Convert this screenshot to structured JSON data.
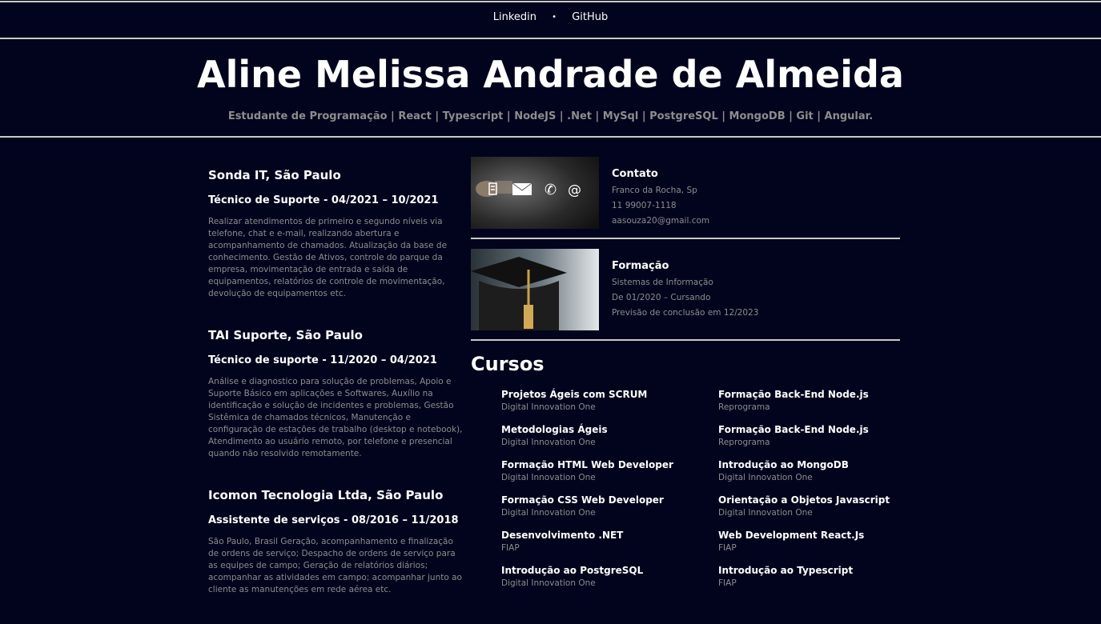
{
  "nav": {
    "links": [
      "Linkedin",
      "GitHub"
    ],
    "separator": "•"
  },
  "header": {
    "name": "Aline Melissa Andrade de Almeida",
    "subtitle": "Estudante de Programação | React | Typescript | NodeJS | .Net | MySql | PostgreSQL | MongoDB | Git | Angular."
  },
  "experience": [
    {
      "company": "Sonda IT, São Paulo",
      "role": "Técnico de Suporte - 04/2021 – 10/2021",
      "description": "Realizar atendimentos de primeiro e segundo níveis via telefone, chat e e-mail, realizando abertura e acompanhamento de chamados. Atualização da base de conhecimento. Gestão de Ativos, controle do parque da empresa, movimentação de entrada e saída de equipamentos, relatórios de controle de movimentação, devolução de equipamentos etc."
    },
    {
      "company": "TAI Suporte, São Paulo",
      "role": "Técnico de suporte - 11/2020 – 04/2021",
      "description": "Análise e diagnostico para solução de problemas, Apoio e Suporte Básico em aplicações e Softwares, Auxílio na identificação e solução de incidentes e problemas, Gestão Sistêmica de chamados técnicos, Manutenção e configuração de estações de trabalho (desktop e notebook), Atendimento ao usuário remoto, por telefone e presencial quando não resolvido remotamente."
    },
    {
      "company": "Icomon Tecnologia Ltda, São Paulo",
      "role": "Assistente de serviços - 08/2016 – 11/2018",
      "description": "São Paulo, Brasil Geração, acompanhamento e finalização de ordens de serviço; Despacho de ordens de serviço para as equipes de campo; Geração de relatórios diários; acompanhar as atividades em campo; acompanhar junto ao cliente as manutenções em rede aérea etc."
    }
  ],
  "contact": {
    "title": "Contato",
    "location": "Franco da Rocha, Sp",
    "phone": "11 99007-1118",
    "email": "aasouza20@gmail.com",
    "icons": [
      "building-icon",
      "envelope-icon",
      "phone-icon",
      "at-icon"
    ]
  },
  "education": {
    "title": "Formação",
    "course": "Sistemas de Informação",
    "period": "De 01/2020 – Cursando",
    "completion": "Previsão de conclusão em 12/2023"
  },
  "courses": {
    "title": "Cursos",
    "left": [
      {
        "name": "Projetos Ágeis com SCRUM",
        "institution": "Digital Innovation One"
      },
      {
        "name": "Metodologias Ágeis",
        "institution": "Digital Innovation One"
      },
      {
        "name": "Formação HTML Web Developer",
        "institution": "Digital Innovation One"
      },
      {
        "name": "Formação CSS Web Developer",
        "institution": "Digital Innovation One"
      },
      {
        "name": "Desenvolvimento .NET",
        "institution": "FIAP"
      },
      {
        "name": "Introdução ao PostgreSQL",
        "institution": "Digital Innovation One"
      }
    ],
    "right": [
      {
        "name": "Formação Back-End Node.js",
        "institution": "Reprograma"
      },
      {
        "name": "Formação Back-End Node.js",
        "institution": "Reprograma"
      },
      {
        "name": "Introdução ao MongoDB",
        "institution": "Digital Innovation One"
      },
      {
        "name": "Orientação a Objetos Javascript",
        "institution": "Digital Innovation One"
      },
      {
        "name": "Web Development React.Js",
        "institution": "FIAP"
      },
      {
        "name": "Introdução ao Typescript",
        "institution": "FIAP"
      }
    ]
  }
}
